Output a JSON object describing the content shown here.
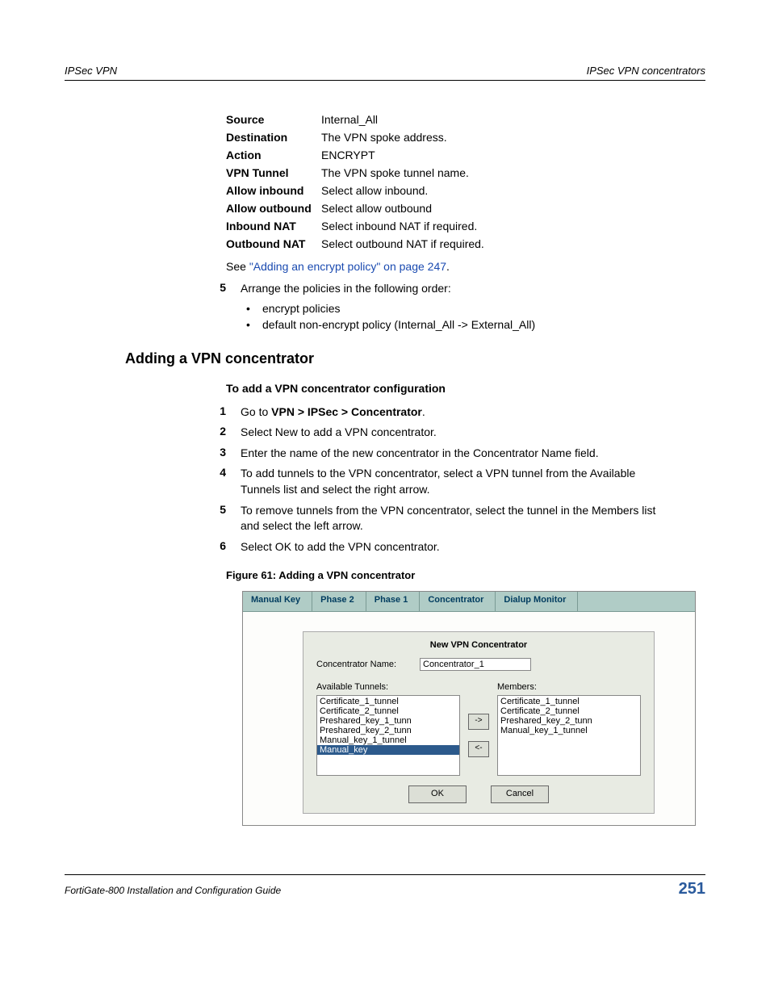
{
  "header": {
    "left": "IPSec VPN",
    "right": "IPSec VPN concentrators"
  },
  "defs": [
    {
      "label": "Source",
      "value": "Internal_All"
    },
    {
      "label": "Destination",
      "value": "The VPN spoke address."
    },
    {
      "label": "Action",
      "value": "ENCRYPT"
    },
    {
      "label": "VPN Tunnel",
      "value": "The VPN spoke tunnel name."
    },
    {
      "label": "Allow inbound",
      "value": "Select allow inbound."
    },
    {
      "label": "Allow outbound",
      "value": "Select allow outbound"
    },
    {
      "label": "Inbound NAT",
      "value": "Select inbound NAT if required."
    },
    {
      "label": "Outbound NAT",
      "value": "Select outbound NAT if required."
    }
  ],
  "see": {
    "prefix": "See ",
    "link": "\"Adding an encrypt policy\" on page 247",
    "suffix": "."
  },
  "upper_step": {
    "num": "5",
    "text": "Arrange the policies in the following order:",
    "bullets": [
      "encrypt policies",
      "default non-encrypt policy (Internal_All -> External_All)"
    ]
  },
  "section_title": "Adding a VPN concentrator",
  "sub_head": "To add a VPN concentrator configuration",
  "steps": [
    {
      "num": "1",
      "html": "Go to <b>VPN > IPSec > Concentrator</b>."
    },
    {
      "num": "2",
      "html": "Select New to add a VPN concentrator."
    },
    {
      "num": "3",
      "html": "Enter the name of the new concentrator in the Concentrator Name field."
    },
    {
      "num": "4",
      "html": "To add tunnels to the VPN concentrator, select a VPN tunnel from the Available Tunnels list and select the right arrow."
    },
    {
      "num": "5",
      "html": "To remove tunnels from the VPN concentrator, select the tunnel in the Members list and select the left arrow."
    },
    {
      "num": "6",
      "html": "Select OK to add the VPN concentrator."
    }
  ],
  "figure_caption": "Figure 61: Adding a VPN concentrator",
  "tabs": [
    "Manual Key",
    "Phase 2",
    "Phase 1",
    "Concentrator",
    "Dialup Monitor"
  ],
  "panel": {
    "title": "New VPN Concentrator",
    "name_label": "Concentrator Name:",
    "name_value": "Concentrator_1",
    "avail_label": "Available Tunnels:",
    "members_label": "Members:",
    "available": [
      {
        "text": "Certificate_1_tunnel",
        "sel": false
      },
      {
        "text": "Certificate_2_tunnel",
        "sel": false
      },
      {
        "text": "Preshared_key_1_tunn",
        "sel": false
      },
      {
        "text": "Preshared_key_2_tunn",
        "sel": false
      },
      {
        "text": "Manual_key_1_tunnel",
        "sel": false
      },
      {
        "text": "Manual_key",
        "sel": true
      }
    ],
    "members": [
      "Certificate_1_tunnel",
      "Certificate_2_tunnel",
      "Preshared_key_2_tunn",
      "Manual_key_1_tunnel"
    ],
    "arrow_right": "->",
    "arrow_left": "<-",
    "ok": "OK",
    "cancel": "Cancel"
  },
  "footer": {
    "doc": "FortiGate-800 Installation and Configuration Guide",
    "page": "251"
  }
}
